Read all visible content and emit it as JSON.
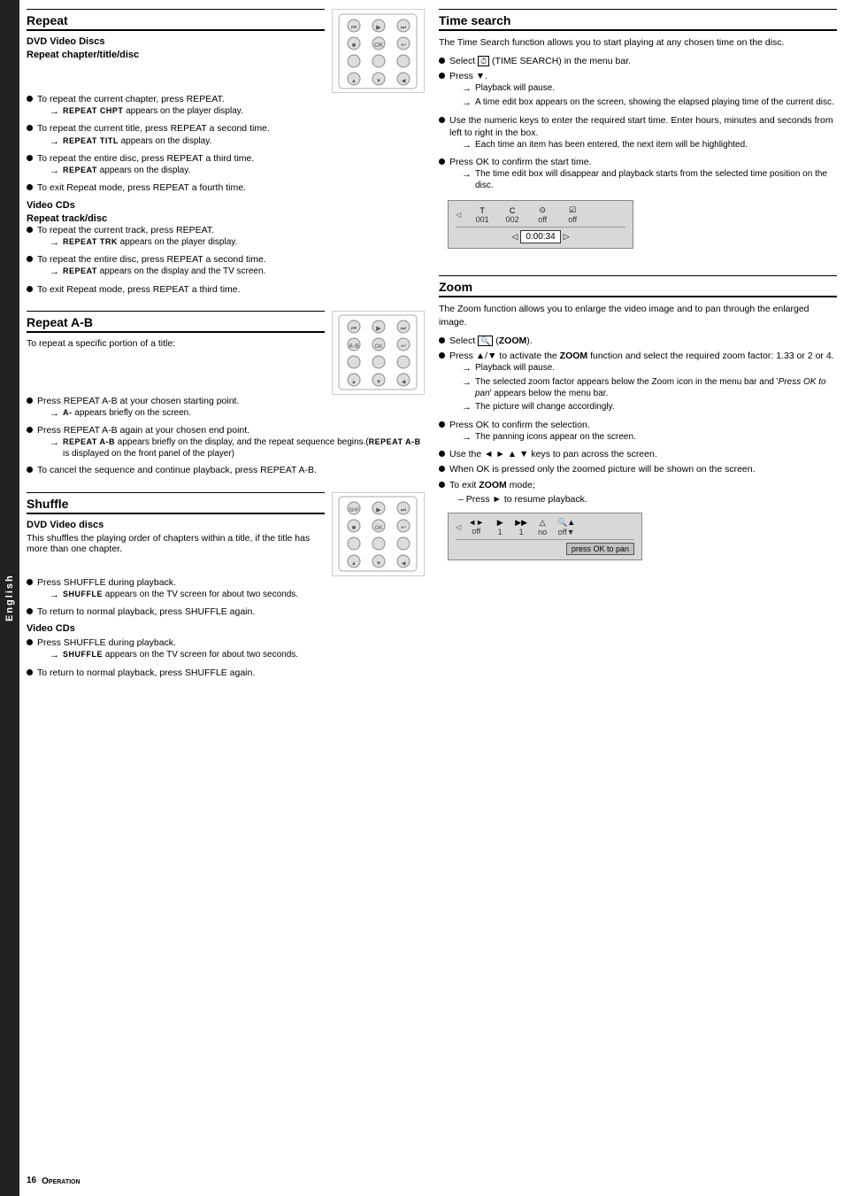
{
  "sidebar": {
    "label": "English"
  },
  "page": {
    "number": "16",
    "section_label": "Operation"
  },
  "left": {
    "repeat": {
      "title": "Repeat",
      "dvd_subtitle": "DVD Video Discs",
      "dvd_subtitle2": "Repeat chapter/title/disc",
      "dvd_bullets": [
        {
          "text": "To repeat the current chapter, press REPEAT.",
          "arrows": [
            "REPEAT CHPT appears on the player display."
          ]
        },
        {
          "text": "To repeat the current title, press REPEAT a second time.",
          "arrows": [
            "REPEAT TITL appears on the display."
          ]
        },
        {
          "text": "To repeat the entire disc, press REPEAT a third time.",
          "arrows": [
            "REPEAT appears on the display."
          ]
        },
        {
          "text": "To exit Repeat mode, press REPEAT a fourth time.",
          "arrows": []
        }
      ],
      "vcd_subtitle": "Video CDs",
      "vcd_subtitle2": "Repeat track/disc",
      "vcd_bullets": [
        {
          "text": "To repeat the current track, press REPEAT.",
          "arrows": [
            "REPEAT TRK appears on the player display."
          ]
        },
        {
          "text": "To repeat the entire disc, press REPEAT a second time.",
          "arrows": [
            "REPEAT appears on the display and the TV screen."
          ]
        },
        {
          "text": "To exit Repeat mode, press REPEAT a third time.",
          "arrows": []
        }
      ]
    },
    "repeat_ab": {
      "title": "Repeat A-B",
      "intro": "To repeat a specific portion of a title:",
      "bullets": [
        {
          "text": "Press REPEAT A-B at your chosen starting point.",
          "arrows": [
            "A- appears briefly on the screen."
          ]
        },
        {
          "text": "Press REPEAT A-B again at your chosen end point.",
          "arrows": [
            "REPEAT A-B appears briefly on the display, and the repeat sequence begins.(REPEAT A-B is displayed on the front panel of the player)"
          ]
        },
        {
          "text": "To cancel the sequence and continue playback, press REPEAT A-B.",
          "arrows": []
        }
      ]
    },
    "shuffle": {
      "title": "Shuffle",
      "dvd_subtitle": "DVD Video discs",
      "dvd_intro": "This shuffles the playing order of chapters within a title, if the title has more than one chapter.",
      "dvd_bullets": [
        {
          "text": "Press SHUFFLE during playback.",
          "arrows": [
            "SHUFFLE appears on the TV screen for about two seconds."
          ]
        },
        {
          "text": "To return to normal playback, press SHUFFLE again.",
          "arrows": []
        }
      ],
      "vcd_subtitle": "Video CDs",
      "vcd_bullets": [
        {
          "text": "Press SHUFFLE during playback.",
          "arrows": [
            "SHUFFLE appears on the TV screen for about two seconds."
          ]
        },
        {
          "text": "To return to normal playback, press SHUFFLE again.",
          "arrows": []
        }
      ]
    }
  },
  "right": {
    "time_search": {
      "title": "Time search",
      "intro": "The Time Search function allows you to start playing at any chosen time on the disc.",
      "bullets": [
        {
          "text": "Select",
          "bold_part": " (TIME SEARCH) in the menu bar.",
          "arrows": []
        },
        {
          "text": "Press ▼.",
          "arrows": [
            "Playback will pause.",
            "A time edit box appears on the screen, showing the elapsed playing time of the current disc."
          ]
        },
        {
          "text": "Use the numeric keys to enter the required start time. Enter hours, minutes and seconds from left to right in the box.",
          "arrows": [
            "Each time an item has been entered, the next item will be highlighted."
          ]
        },
        {
          "text": "Press OK to confirm the start time.",
          "arrows": [
            "The time edit box will disappear and playback starts from the selected time position on the disc."
          ]
        }
      ],
      "display": {
        "cells": [
          "T",
          "C",
          "⊙",
          "☑"
        ],
        "values": [
          "001",
          "002",
          "off",
          "off"
        ],
        "time_label": "◁ 0:00:34 ▷"
      }
    },
    "zoom": {
      "title": "Zoom",
      "intro": "The Zoom function allows you to enlarge the video image and to pan through the enlarged image.",
      "bullets": [
        {
          "text": "Select",
          "bold_part": " (ZOOM).",
          "arrows": []
        },
        {
          "text": "Press ▲/▼ to activate the ZOOM function and select the required zoom factor: 1.33 or 2 or 4.",
          "arrows": [
            "Playback will pause.",
            "The selected zoom factor appears below the Zoom icon in the menu bar and 'Press OK to pan' appears below the menu bar.",
            "The picture will change accordingly."
          ]
        },
        {
          "text": "Press OK to confirm the selection.",
          "arrows": [
            "The panning icons appear on the screen."
          ]
        },
        {
          "text": "Use the ◄ ► ▲ ▼ keys to pan across the screen.",
          "arrows": []
        },
        {
          "text": "When OK is pressed only the zoomed picture will be shown on the screen.",
          "arrows": []
        },
        {
          "text": "To exit ZOOM mode:",
          "sub": "– Press ► to resume playback.",
          "arrows": []
        }
      ],
      "display": {
        "cells": [
          "◄►",
          "▶",
          "▶▶",
          "△",
          "🔍▲"
        ],
        "values": [
          "off",
          "1",
          "1",
          "no",
          "off ▼"
        ],
        "ok_label": "press OK to pan"
      }
    }
  }
}
